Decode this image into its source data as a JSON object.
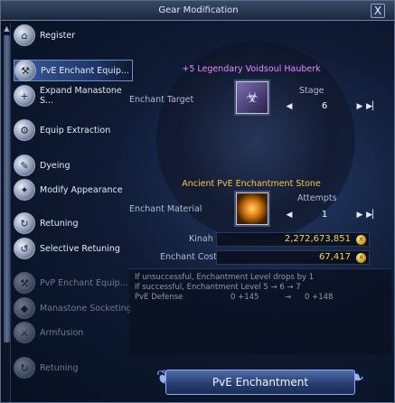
{
  "window": {
    "title": "Gear Modification",
    "close_label": "X"
  },
  "sidebar": {
    "items": [
      {
        "label": "Register",
        "glyph": "⌂",
        "state": "normal"
      },
      {
        "label": "PvE Enchant Equip...",
        "glyph": "⚒",
        "state": "active"
      },
      {
        "label": "Expand Manastone S...",
        "glyph": "+",
        "state": "normal"
      },
      {
        "label": "Equip Extraction",
        "glyph": "⚙",
        "state": "normal"
      },
      {
        "label": "Dyeing",
        "glyph": "✎",
        "state": "normal"
      },
      {
        "label": "Modify Appearance",
        "glyph": "✦",
        "state": "normal"
      },
      {
        "label": "Retuning",
        "glyph": "↻",
        "state": "normal"
      },
      {
        "label": "Selective Retuning",
        "glyph": "↺",
        "state": "normal"
      },
      {
        "label": "PvP Enchant Equip...",
        "glyph": "⚒",
        "state": "disabled"
      },
      {
        "label": "Manastone Socketing",
        "glyph": "◆",
        "state": "disabled"
      },
      {
        "label": "Armfusion",
        "glyph": "⚔",
        "state": "disabled"
      },
      {
        "label": "Retuning",
        "glyph": "↻",
        "state": "disabled"
      }
    ]
  },
  "target": {
    "item_name": "+5 Legendary Voidsoul Hauberk",
    "label": "Enchant Target",
    "stage_label": "Stage",
    "stage_value": "6"
  },
  "material": {
    "item_name": "Ancient PvE Enchantment Stone",
    "label": "Enchant Material",
    "attempts_label": "Attempts",
    "attempts_value": "1"
  },
  "costs": {
    "kinah_label": "Kinah",
    "kinah_value": "2,272,673,851",
    "cost_label": "Enchant Cost",
    "cost_value": "67,417"
  },
  "info": {
    "line1": "If unsuccessful, Enchantment Level drops by 1",
    "line2": "If successful, Enchantment Level 5 → 6 → 7",
    "stat_name": "PvE Defense",
    "stat_from": "0 +145",
    "arrow": "→",
    "stat_to": "0 +148"
  },
  "action": {
    "button_label": "PvE Enchantment"
  },
  "icons": {
    "prev": "◀",
    "next": "▶",
    "last": "▶▏",
    "coin": "¤",
    "scroll_up": "▲"
  },
  "colors": {
    "item_legendary": "#e58cff",
    "item_material": "#f5c744",
    "currency": "#f2d35a",
    "accent": "#6d8fd0"
  }
}
